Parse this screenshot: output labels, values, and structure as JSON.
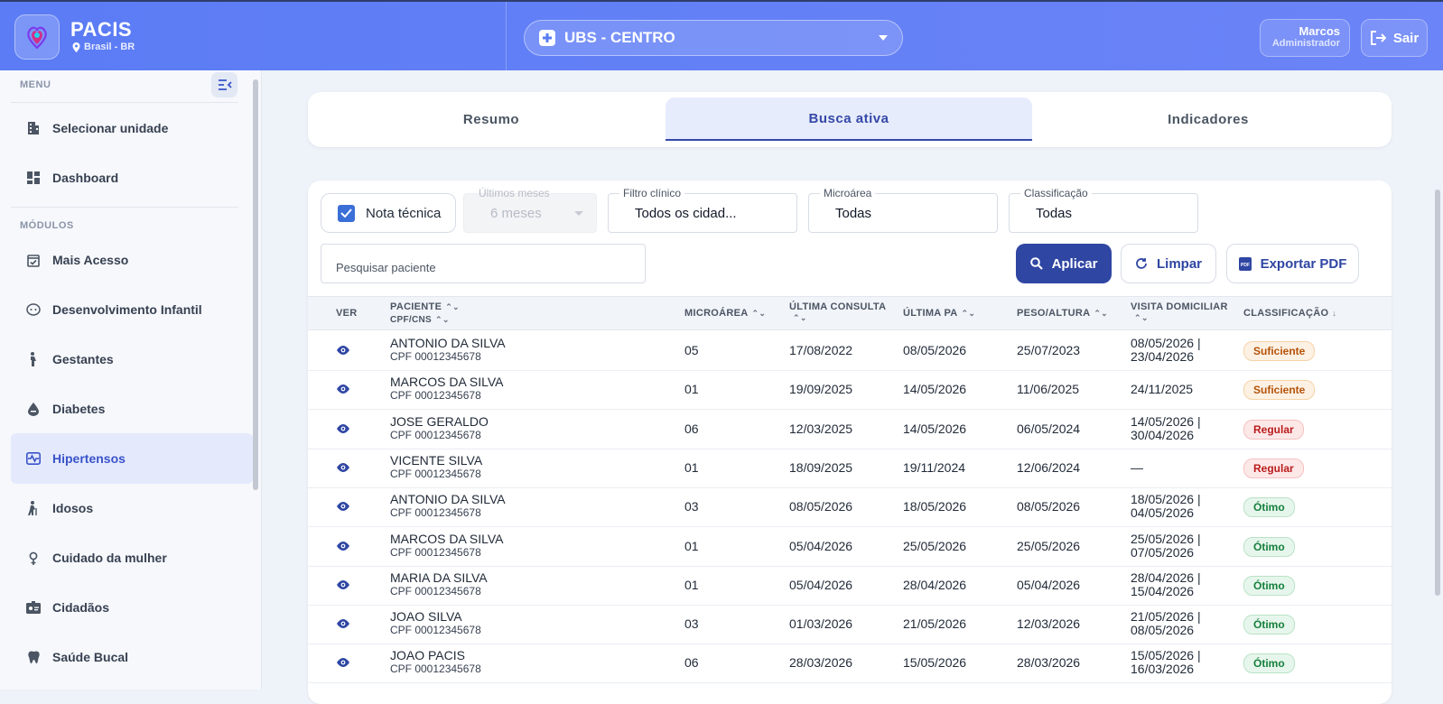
{
  "header": {
    "app_name": "PACIS",
    "location": "Brasil - BR",
    "unit": "UBS - CENTRO",
    "user_name": "Marcos",
    "user_role": "Administrador",
    "logout": "Sair"
  },
  "sidebar": {
    "menu_title": "MENU",
    "modules_title": "MÓDULOS",
    "menu_items": [
      {
        "label": "Selecionar unidade",
        "icon": "building-icon"
      },
      {
        "label": "Dashboard",
        "icon": "dashboard-icon"
      }
    ],
    "module_items": [
      {
        "label": "Mais Acesso",
        "icon": "calendar-check-icon"
      },
      {
        "label": "Desenvolvimento Infantil",
        "icon": "child-face-icon"
      },
      {
        "label": "Gestantes",
        "icon": "pregnant-icon"
      },
      {
        "label": "Diabetes",
        "icon": "drop-icon"
      },
      {
        "label": "Hipertensos",
        "icon": "heartbeat-icon",
        "active": true
      },
      {
        "label": "Idosos",
        "icon": "elderly-icon"
      },
      {
        "label": "Cuidado da mulher",
        "icon": "female-icon"
      },
      {
        "label": "Cidadãos",
        "icon": "id-badge-icon"
      },
      {
        "label": "Saúde Bucal",
        "icon": "tooth-icon"
      }
    ]
  },
  "tabs": [
    "Resumo",
    "Busca ativa",
    "Indicadores"
  ],
  "active_tab": "Busca ativa",
  "filters": {
    "nota_tecnica": "Nota técnica",
    "nota_checked": true,
    "ultimos_meses_label": "Últimos meses",
    "ultimos_meses_value": "6 meses",
    "filtro_clinico_label": "Filtro clínico",
    "filtro_clinico_value": "Todos os cidad...",
    "microarea_label": "Microárea",
    "microarea_value": "Todas",
    "classificacao_label": "Classificação",
    "classificacao_value": "Todas",
    "search_placeholder": "Pesquisar paciente",
    "apply": "Aplicar",
    "clear": "Limpar",
    "export": "Exportar PDF"
  },
  "table": {
    "headers": {
      "ver": "VER",
      "paciente": "PACIENTE",
      "cpf": "CPF/CNS",
      "microarea": "MICROÁREA",
      "ultima_consulta": "ÚLTIMA CONSULTA",
      "ultima_pa": "ÚLTIMA PA",
      "peso_altura": "PESO/ALTURA",
      "visita": "VISITA DOMICILIAR",
      "classificacao": "CLASSIFICAÇÃO"
    },
    "rows": [
      {
        "name": "ANTONIO DA SILVA",
        "doc": "CPF 00012345678",
        "micro": "05",
        "consulta": "17/08/2022",
        "pa": "08/05/2026",
        "peso": "25/07/2023",
        "visita1": "08/05/2026 |",
        "visita2": "23/04/2026",
        "class": "Suficiente",
        "kind": "suf"
      },
      {
        "name": "MARCOS DA SILVA",
        "doc": "CPF 00012345678",
        "micro": "01",
        "consulta": "19/09/2025",
        "pa": "14/05/2026",
        "peso": "11/06/2025",
        "visita1": "24/11/2025",
        "visita2": "",
        "class": "Suficiente",
        "kind": "suf"
      },
      {
        "name": "JOSE GERALDO",
        "doc": "CPF 00012345678",
        "micro": "06",
        "consulta": "12/03/2025",
        "pa": "14/05/2026",
        "peso": "06/05/2024",
        "visita1": "14/05/2026 |",
        "visita2": "30/04/2026",
        "class": "Regular",
        "kind": "reg"
      },
      {
        "name": "VICENTE SILVA",
        "doc": "CPF 00012345678",
        "micro": "01",
        "consulta": "18/09/2025",
        "pa": "19/11/2024",
        "peso": "12/06/2024",
        "visita1": "—",
        "visita2": "",
        "class": "Regular",
        "kind": "reg"
      },
      {
        "name": "ANTONIO DA SILVA",
        "doc": "CPF 00012345678",
        "micro": "03",
        "consulta": "08/05/2026",
        "pa": "18/05/2026",
        "peso": "08/05/2026",
        "visita1": "18/05/2026 |",
        "visita2": "04/05/2026",
        "class": "Ótimo",
        "kind": "oti"
      },
      {
        "name": "MARCOS DA SILVA",
        "doc": "CPF 00012345678",
        "micro": "01",
        "consulta": "05/04/2026",
        "pa": "25/05/2026",
        "peso": "25/05/2026",
        "visita1": "25/05/2026 |",
        "visita2": "07/05/2026",
        "class": "Ótimo",
        "kind": "oti"
      },
      {
        "name": "MARIA DA SILVA",
        "doc": "CPF 00012345678",
        "micro": "01",
        "consulta": "05/04/2026",
        "pa": "28/04/2026",
        "peso": "05/04/2026",
        "visita1": "28/04/2026 |",
        "visita2": "15/04/2026",
        "class": "Ótimo",
        "kind": "oti"
      },
      {
        "name": "JOAO SILVA",
        "doc": "CPF 00012345678",
        "micro": "03",
        "consulta": "01/03/2026",
        "pa": "21/05/2026",
        "peso": "12/03/2026",
        "visita1": "21/05/2026 |",
        "visita2": "08/05/2026",
        "class": "Ótimo",
        "kind": "oti"
      },
      {
        "name": "JOAO PACIS",
        "doc": "CPF 00012345678",
        "micro": "06",
        "consulta": "28/03/2026",
        "pa": "15/05/2026",
        "peso": "28/03/2026",
        "visita1": "15/05/2026 |",
        "visita2": "16/03/2026",
        "class": "Ótimo",
        "kind": "oti"
      }
    ]
  },
  "colors": {
    "primary": "#2f46a3",
    "header": "#5b7cf5",
    "active_nav": "#3a53c9"
  }
}
